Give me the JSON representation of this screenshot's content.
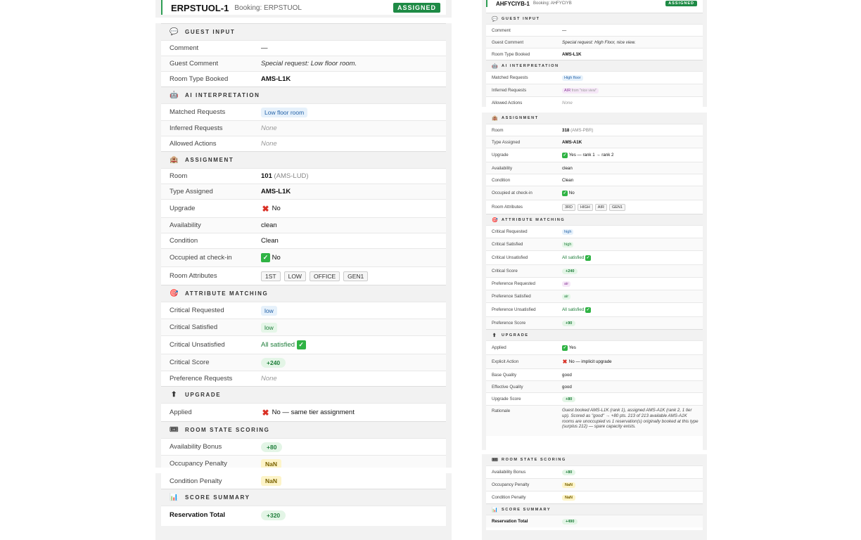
{
  "left": {
    "booking_id": "ERPSTUOL-1",
    "booking_label": "Booking: ERPSTUOL",
    "status": "ASSIGNED",
    "guest_input": {
      "title": "GUEST INPUT",
      "comment_label": "Comment",
      "comment": "—",
      "guest_comment_label": "Guest Comment",
      "guest_comment": "Special request: Low floor room.",
      "room_type_booked_label": "Room Type Booked",
      "room_type_booked": "AMS-L1K"
    },
    "ai_interpretation": {
      "title": "AI INTERPRETATION",
      "matched_label": "Matched Requests",
      "matched": "Low floor room",
      "inferred_label": "Inferred Requests",
      "inferred": "None",
      "allowed_label": "Allowed Actions",
      "allowed": "None"
    },
    "assignment": {
      "title": "ASSIGNMENT",
      "room_label": "Room",
      "room": "101",
      "room_code": "(AMS-LUD)",
      "type_label": "Type Assigned",
      "type": "AMS-L1K",
      "upgrade_label": "Upgrade",
      "upgrade": "No",
      "availability_label": "Availability",
      "availability": "clean",
      "condition_label": "Condition",
      "condition": "Clean",
      "occupied_label": "Occupied at check-in",
      "occupied": "No",
      "attributes_label": "Room Attributes",
      "attributes": [
        "1ST",
        "LOW",
        "OFFICE",
        "GEN1"
      ]
    },
    "attribute_matching": {
      "title": "ATTRIBUTE MATCHING",
      "crit_req_label": "Critical Requested",
      "crit_req": "low",
      "crit_sat_label": "Critical Satisfied",
      "crit_sat": "low",
      "crit_unsat_label": "Critical Unsatisfied",
      "crit_unsat": "All satisfied",
      "crit_score_label": "Critical Score",
      "crit_score": "+240",
      "pref_req_label": "Preference Requests",
      "pref_req": "None"
    },
    "upgrade": {
      "title": "UPGRADE",
      "applied_label": "Applied",
      "applied": "No — same tier assignment"
    },
    "room_state": {
      "title": "ROOM STATE SCORING",
      "avail_bonus_label": "Availability Bonus",
      "avail_bonus": "+80",
      "occ_pen_label": "Occupancy Penalty",
      "occ_pen": "NaN",
      "cond_pen_label": "Condition Penalty",
      "cond_pen": "NaN"
    },
    "summary": {
      "title": "SCORE SUMMARY",
      "total_label": "Reservation Total",
      "total": "+320"
    }
  },
  "right": {
    "booking_id": "AHFYCIYB-1",
    "booking_label": "Booking: AHFYCIYB",
    "status": "ASSIGNED",
    "guest_input": {
      "title": "GUEST INPUT",
      "comment_label": "Comment",
      "comment": "—",
      "guest_comment_label": "Guest Comment",
      "guest_comment": "Special request: High Floor, nice view.",
      "room_type_booked_label": "Room Type Booked",
      "room_type_booked": "AMS-L1K"
    },
    "ai_interpretation": {
      "title": "AI INTERPRETATION",
      "matched_label": "Matched Requests",
      "matched": "High floor",
      "inferred_label": "Inferred Requests",
      "inferred": "AIR",
      "inferred_src": "from \"nice view\"",
      "allowed_label": "Allowed Actions",
      "allowed": "None"
    },
    "assignment": {
      "title": "ASSIGNMENT",
      "room_label": "Room",
      "room": "318",
      "room_code": "(AMS-PBR)",
      "type_label": "Type Assigned",
      "type": "AMS-A1K",
      "upgrade_label": "Upgrade",
      "upgrade": "Yes — rank 1 → rank 2",
      "availability_label": "Availability",
      "availability": "clean",
      "condition_label": "Condition",
      "condition": "Clean",
      "occupied_label": "Occupied at check-in",
      "occupied": "No",
      "attributes_label": "Room Attributes",
      "attributes": [
        "3RD",
        "HIGH",
        "AIR",
        "GEN1"
      ]
    },
    "attribute_matching": {
      "title": "ATTRIBUTE MATCHING",
      "crit_req_label": "Critical Requested",
      "crit_req": "high",
      "crit_sat_label": "Critical Satisfied",
      "crit_sat": "high",
      "crit_unsat_label": "Critical Unsatisfied",
      "crit_unsat": "All satisfied",
      "crit_score_label": "Critical Score",
      "crit_score": "+240",
      "pref_req_label": "Preference Requested",
      "pref_req": "air",
      "pref_sat_label": "Preference Satisfied",
      "pref_sat": "air",
      "pref_unsat_label": "Preference Unsatisfied",
      "pref_unsat": "All satisfied",
      "pref_score_label": "Preference Score",
      "pref_score": "+90"
    },
    "upgrade": {
      "title": "UPGRADE",
      "applied_label": "Applied",
      "applied": "Yes",
      "explicit_label": "Explicit Action",
      "explicit": "No — implicit upgrade",
      "base_q_label": "Base Quality",
      "base_q": "good",
      "eff_q_label": "Effective Quality",
      "eff_q": "good",
      "score_label": "Upgrade Score",
      "score": "+80",
      "rationale_label": "Rationale",
      "rationale": "Guest booked AMS-L1K (rank 1), assigned AMS-A1K (rank 2, 1 tier up). Scored as \"good\" → +80 pts. 213 of 213 available AMS-A1K rooms are unoccupied vs 1 reservation(s) originally booked at this type (surplus 212) — spare capacity exists."
    },
    "room_state": {
      "title": "ROOM STATE SCORING",
      "avail_bonus_label": "Availability Bonus",
      "avail_bonus": "+80",
      "occ_pen_label": "Occupancy Penalty",
      "occ_pen": "NaN",
      "cond_pen_label": "Condition Penalty",
      "cond_pen": "NaN"
    },
    "summary": {
      "title": "SCORE SUMMARY",
      "total_label": "Reservation Total",
      "total": "+490"
    }
  },
  "icons": {
    "guest_input": "speech-bubble-icon",
    "ai": "robot-icon",
    "assignment": "hotel-icon",
    "matching": "target-icon",
    "upgrade": "up-arrow-icon",
    "room_state": "ticket-icon",
    "summary": "bar-chart-icon",
    "check": "check-icon",
    "cross": "cross-icon"
  }
}
